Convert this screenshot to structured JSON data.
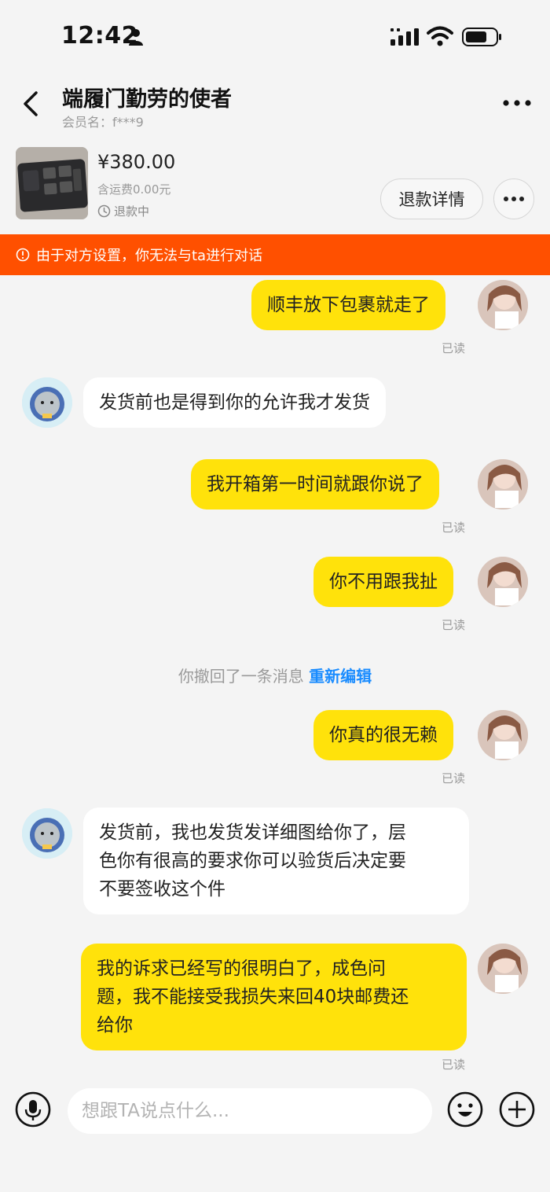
{
  "status_bar": {
    "time": "12:42"
  },
  "header": {
    "seller_name": "端履门勤劳的使者",
    "member_label": "会员名：f***9"
  },
  "order": {
    "price": "¥380.00",
    "shipping": "含运费0.00元",
    "status": "退款中",
    "refund_button": "退款详情"
  },
  "warning": {
    "text": "由于对方设置，你无法与ta进行对话"
  },
  "messages": {
    "m1": {
      "text": "顺丰放下包裹就走了",
      "read": "已读"
    },
    "m2": {
      "text": "发货前也是得到你的允许我才发货"
    },
    "m3": {
      "text": "我开箱第一时间就跟你说了",
      "read": "已读"
    },
    "m4": {
      "text": "你不用跟我扯",
      "read": "已读"
    },
    "recall": {
      "text": "你撤回了一条消息",
      "action": "重新编辑"
    },
    "m5": {
      "text": "你真的很无赖",
      "read": "已读"
    },
    "m6": {
      "lines": [
        "发货前，我也发货发详细图给你了，层",
        "色你有很高的要求你可以验货后决定要",
        "不要签收这个件"
      ]
    },
    "m7": {
      "lines": [
        "我的诉求已经写的很明白了，成色问",
        "题，我不能接受我损失来回40块邮费还",
        "给你"
      ],
      "read": "已读"
    }
  },
  "input": {
    "placeholder": "想跟TA说点什么..."
  },
  "colors": {
    "accent_yellow": "#ffe20b",
    "warning_orange": "#ff5000",
    "link_blue": "#1a8cff"
  }
}
